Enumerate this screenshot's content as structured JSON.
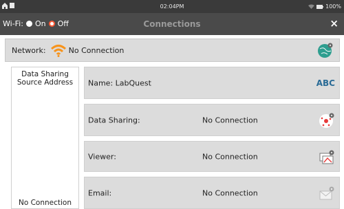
{
  "status": {
    "time": "02:04PM",
    "battery": "100%"
  },
  "title": "Connections",
  "wifi": {
    "label": "Wi-Fi:",
    "on": "On",
    "off": "Off",
    "selected": "Off"
  },
  "network": {
    "label": "Network:",
    "value": "No Connection"
  },
  "data_sharing_panel": {
    "title_line1": "Data Sharing",
    "title_line2": "Source Address",
    "value": "No Connection"
  },
  "name_row": {
    "label": "Name: LabQuest",
    "action": "ABC"
  },
  "rows": [
    {
      "label": "Data Sharing:",
      "value": "No Connection",
      "icon": "data-sharing-settings-icon"
    },
    {
      "label": "Viewer:",
      "value": "No Connection",
      "icon": "viewer-settings-icon"
    },
    {
      "label": "Email:",
      "value": "No Connection",
      "icon": "email-settings-icon"
    }
  ],
  "colors": {
    "accent": "#ff5a36",
    "wifi": "#f7941d",
    "globe": "#2e9e8f"
  }
}
